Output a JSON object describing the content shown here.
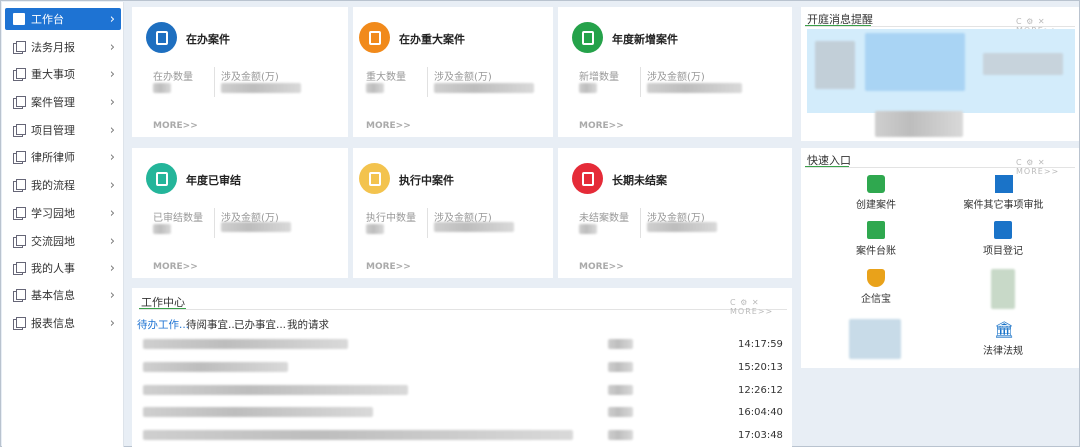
{
  "sidebar": {
    "items": [
      {
        "label": "工作台",
        "active": true
      },
      {
        "label": "法务月报"
      },
      {
        "label": "重大事项"
      },
      {
        "label": "案件管理"
      },
      {
        "label": "项目管理"
      },
      {
        "label": "律所律师"
      },
      {
        "label": "我的流程"
      },
      {
        "label": "学习园地"
      },
      {
        "label": "交流园地"
      },
      {
        "label": "我的人事"
      },
      {
        "label": "基本信息"
      },
      {
        "label": "报表信息"
      }
    ]
  },
  "stats": [
    {
      "title": "在办案件",
      "label1": "在办数量",
      "label2": "涉及金额(万)",
      "more": "MORE>>",
      "color": "#1e6fc0"
    },
    {
      "title": "在办重大案件",
      "label1": "重大数量",
      "label2": "涉及金额(万)",
      "more": "MORE>>",
      "color": "#f18a1b"
    },
    {
      "title": "年度新增案件",
      "label1": "新增数量",
      "label2": "涉及金额(万)",
      "more": "MORE>>",
      "color": "#25a24a"
    },
    {
      "title": "年度已审结",
      "label1": "已审结数量",
      "label2": "涉及金额(万)",
      "more": "MORE>>",
      "color": "#24b59a"
    },
    {
      "title": "执行中案件",
      "label1": "执行中数量",
      "label2": "涉及金额(万)",
      "more": "MORE>>",
      "color": "#f3c34e"
    },
    {
      "title": "长期未结案",
      "label1": "未结案数量",
      "label2": "涉及金额(万)",
      "more": "MORE>>",
      "color": "#e52b38"
    }
  ],
  "work_center": {
    "title": "工作中心",
    "tabs": [
      "待办工作...",
      "待阅事宜...",
      "已办事宜...",
      "我的请求"
    ],
    "times": [
      "14:17:59",
      "15:20:13",
      "12:26:12",
      "16:04:40",
      "17:03:48"
    ]
  },
  "notice": {
    "title": "开庭消息提醒"
  },
  "quick": {
    "title": "快速入口",
    "items": [
      "创建案件",
      "案件其它事项审批",
      "案件台账",
      "项目登记",
      "企信宝",
      "法律法规"
    ]
  },
  "tools": "C ⚙ ✕ MORE>>",
  "icons": [
    "book-icon",
    "pages-icon",
    "chevron-right-icon",
    "file-icon"
  ]
}
